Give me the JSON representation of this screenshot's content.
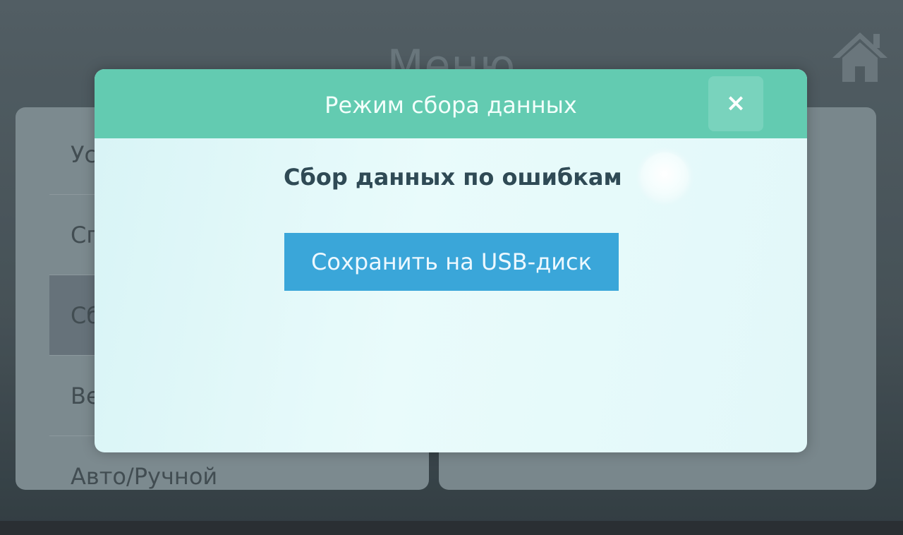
{
  "background": {
    "title": "Меню",
    "home_icon": "home-icon",
    "menu_items": [
      {
        "label": "Ус"
      },
      {
        "label": "Сп"
      },
      {
        "label": "Сб"
      },
      {
        "label": "Ве"
      },
      {
        "label": "Авто/Ручной"
      }
    ],
    "selected_index": 2
  },
  "dialog": {
    "title": "Режим сбора данных",
    "close_icon": "close-icon",
    "close_glyph": "×",
    "option_label": "Сбор данных по ошибкам",
    "toggle_state": "off",
    "usb_button_label": "Сохранить на USB-диск"
  },
  "colors": {
    "dialog_header": "#63cbb1",
    "button_primary": "#3aa6d9",
    "dialog_background": "#e2f8f9"
  }
}
